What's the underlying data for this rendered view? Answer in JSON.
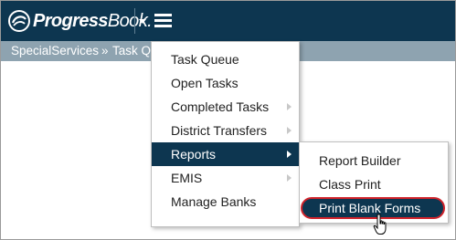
{
  "app": {
    "logo_text_bold": "Progress",
    "logo_text_light": "Book."
  },
  "icons": {
    "logo": "progressbook-logo-icon",
    "dropdown": "caret-down-icon",
    "menu": "hamburger-menu-icon",
    "submenu_arrow": "chevron-right-icon",
    "cursor": "hand-pointer-icon"
  },
  "colors": {
    "topbar": "#0d3650",
    "breadcrumb_bar": "#8ea3b0",
    "active_menu": "#0d3650",
    "highlight_ring": "#d0232b"
  },
  "breadcrumb": {
    "item1": "SpecialServices",
    "separator": "»",
    "item2": "Task Q"
  },
  "menu": {
    "items": [
      {
        "label": "Task Queue"
      },
      {
        "label": "Open Tasks"
      },
      {
        "label": "Completed Tasks"
      },
      {
        "label": "District Transfers"
      },
      {
        "label": "Reports"
      },
      {
        "label": "EMIS"
      },
      {
        "label": "Manage Banks"
      }
    ]
  },
  "submenu": {
    "items": [
      {
        "label": "Report Builder"
      },
      {
        "label": "Class Print"
      },
      {
        "label": "Print Blank Forms"
      }
    ]
  }
}
